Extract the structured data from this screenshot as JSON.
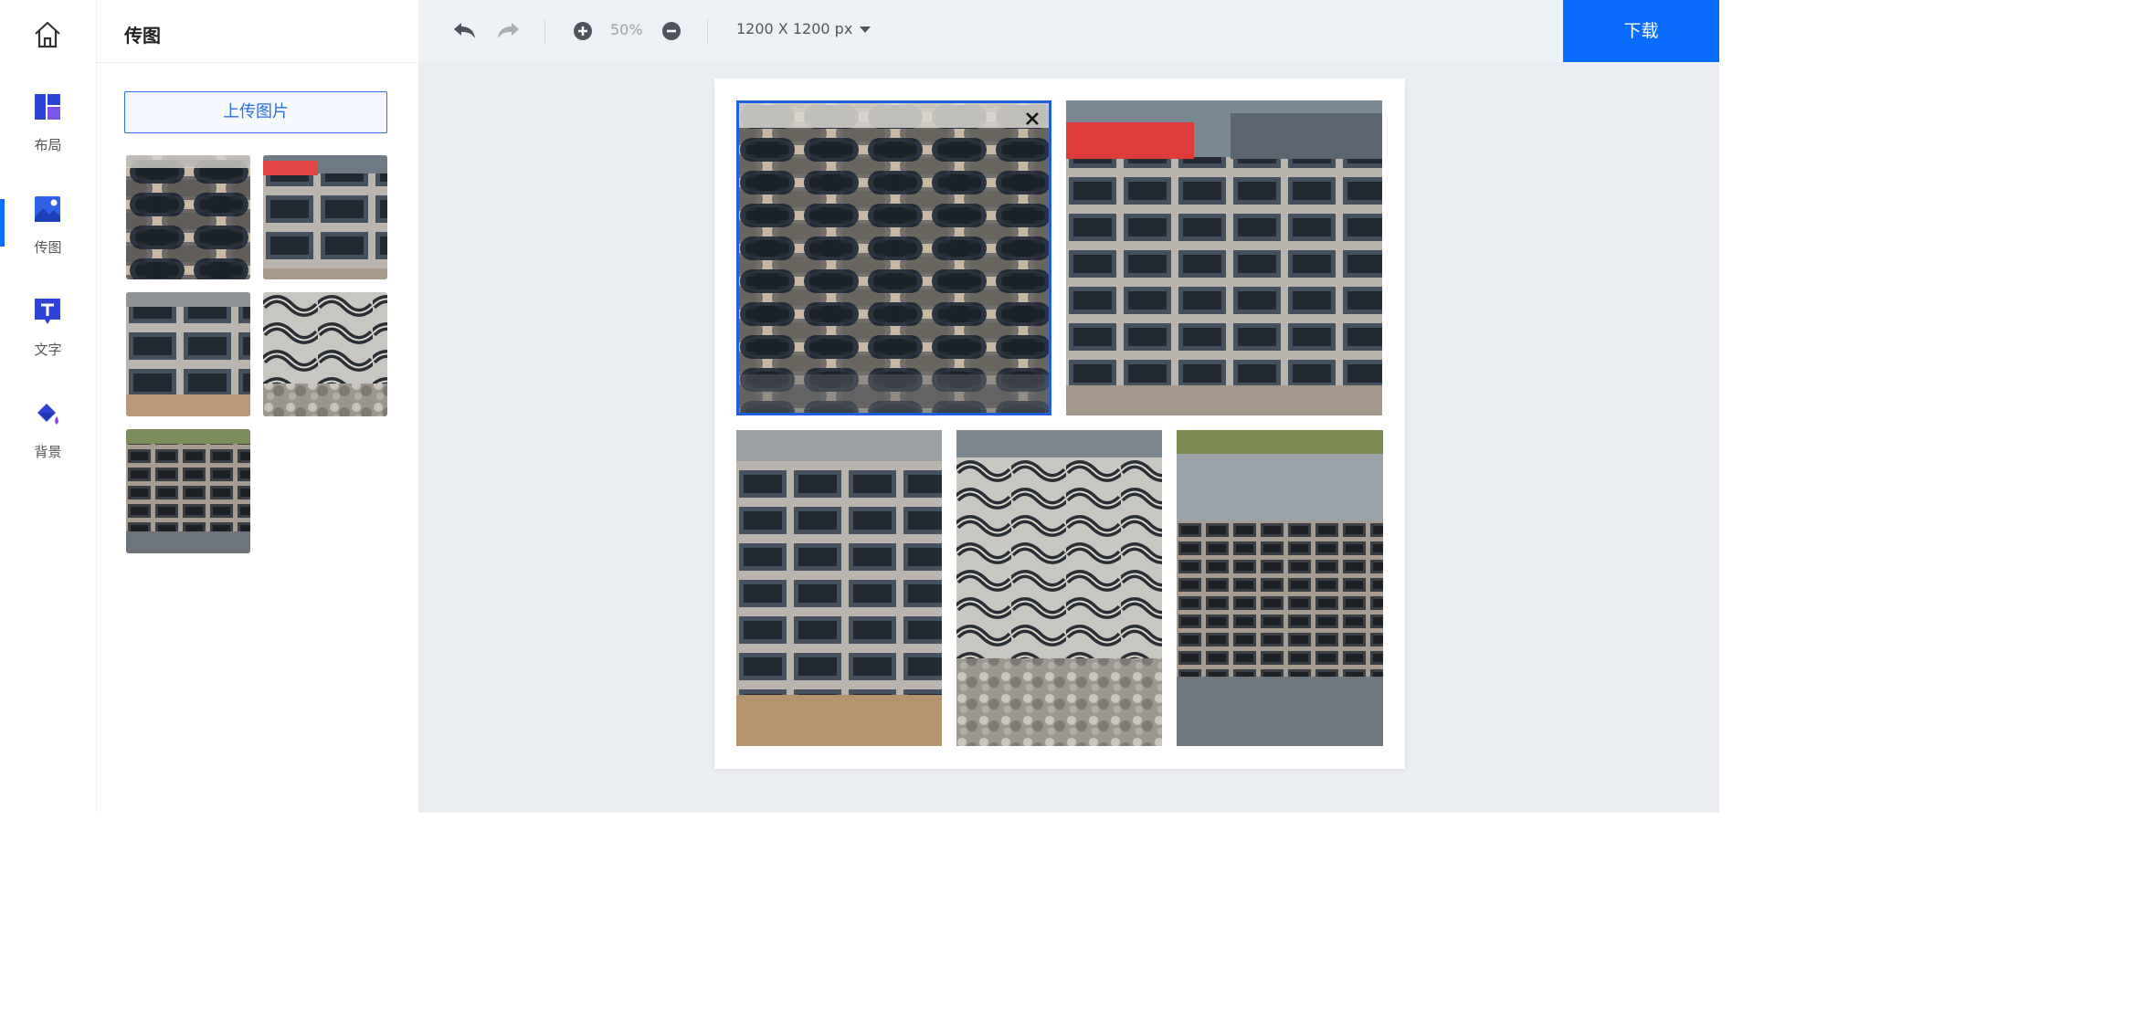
{
  "nav": {
    "home_icon": "home-icon",
    "items": [
      {
        "label": "布局",
        "icon": "layout-icon"
      },
      {
        "label": "传图",
        "icon": "image-upload-icon",
        "active": true
      },
      {
        "label": "文字",
        "icon": "text-icon"
      },
      {
        "label": "背景",
        "icon": "paint-bucket-icon"
      }
    ]
  },
  "panel": {
    "title": "传图",
    "upload_label": "上传图片",
    "thumbnail_count": 5
  },
  "toolbar": {
    "undo_icon": "undo-icon",
    "redo_icon": "redo-icon",
    "zoom_in_icon": "zoom-in-icon",
    "zoom_out_icon": "zoom-out-icon",
    "zoom": "50%",
    "canvas_size": "1200 X 1200 px",
    "download_label": "下载"
  },
  "canvas": {
    "photo_count": 5,
    "selected_photo": 1
  },
  "colors": {
    "accent": "#0a6cff",
    "selection": "#1f5fe0",
    "workspace": "#e9ecf1",
    "nav_icon": "#2b44d6"
  }
}
